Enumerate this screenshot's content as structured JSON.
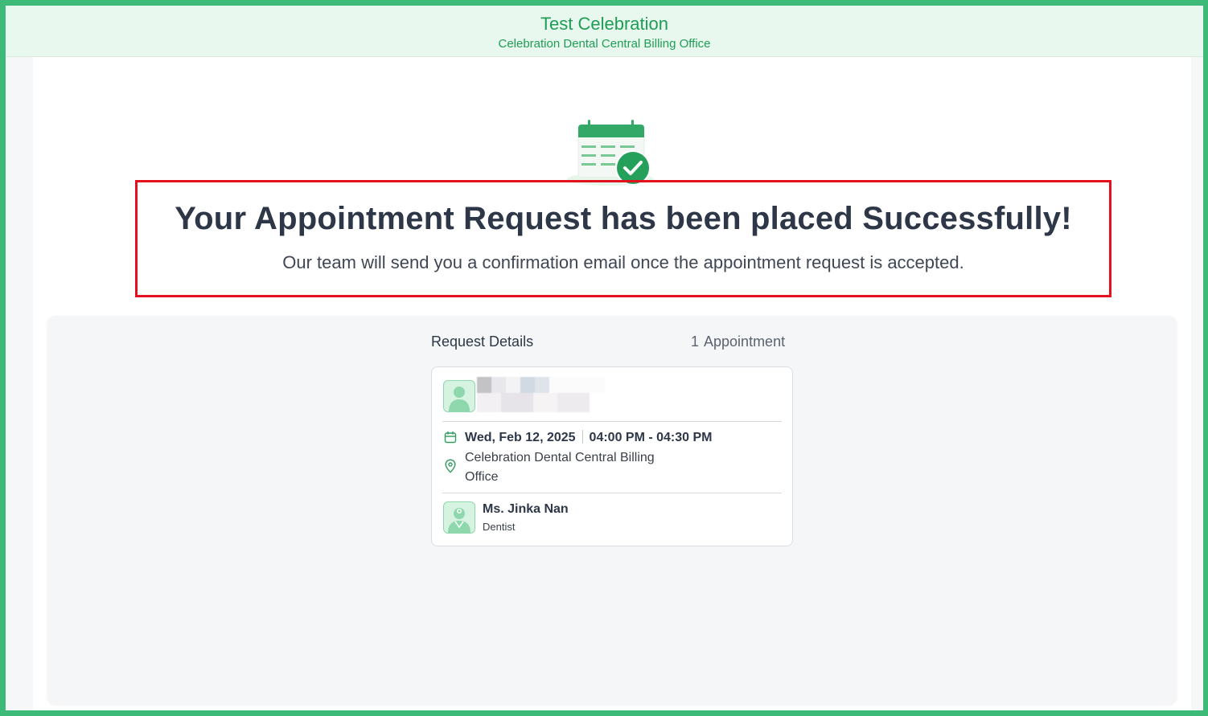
{
  "header": {
    "title": "Test Celebration",
    "subtitle": "Celebration Dental Central Billing Office"
  },
  "hero": {
    "icon": "calendar-check-icon",
    "headline": "Your Appointment Request has been placed Successfully!",
    "message": "Our team will send you a confirmation email once the appointment request is accepted."
  },
  "details": {
    "title": "Request Details",
    "count": "1",
    "count_label": "Appointment",
    "appointment": {
      "patient_avatar_icon": "user-avatar-icon",
      "date": "Wed, Feb 12, 2025",
      "time": "04:00 PM - 04:30 PM",
      "location": "Celebration Dental Central Billing Office",
      "provider_name": "Ms. Jinka Nan",
      "provider_role": "Dentist",
      "provider_icon": "dentist-avatar-icon"
    }
  },
  "colors": {
    "brand_green": "#1f9d55",
    "frame_green": "#3dba78",
    "highlight_red": "#e3101e",
    "header_bg": "#e8f8ee"
  }
}
